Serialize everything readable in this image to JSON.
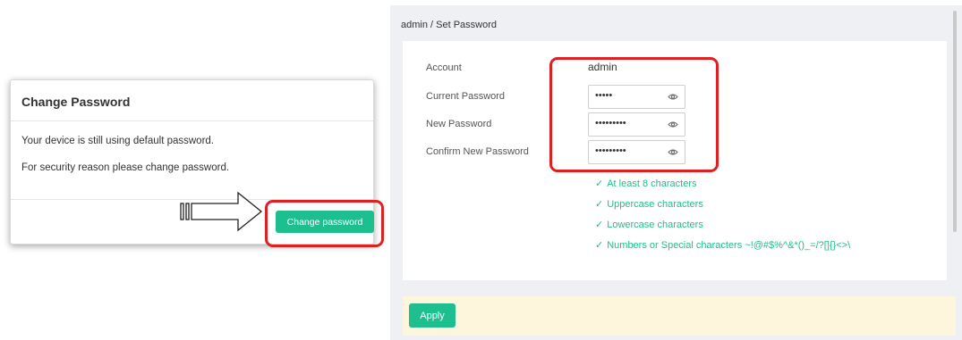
{
  "dialog": {
    "title": "Change Password",
    "message_1": "Your device is still using default password.",
    "message_2": "For security reason please change password.",
    "button_label": "Change password"
  },
  "panel": {
    "breadcrumb": "admin / Set Password",
    "account_label": "Account",
    "account_value": "admin",
    "current_label": "Current Password",
    "current_value": "•••••",
    "new_label": "New Password",
    "new_value": "•••••••••",
    "confirm_label": "Confirm New Password",
    "confirm_value": "•••••••••",
    "requirements": [
      {
        "tick": "✓",
        "text": "At least 8 characters"
      },
      {
        "tick": "✓",
        "text": "Uppercase characters"
      },
      {
        "tick": "✓",
        "text": "Lowercase characters"
      },
      {
        "tick": "✓",
        "text": "Numbers or Special characters ~!@#$%^&*()_=/?[]{}<>\\"
      }
    ],
    "apply_label": "Apply"
  },
  "colors": {
    "accent": "#1dbf8f",
    "highlight": "#e02020",
    "apply_bar": "#fdf6dc"
  },
  "icons": [
    "eye-icon",
    "check-icon",
    "right-arrow-icon"
  ]
}
